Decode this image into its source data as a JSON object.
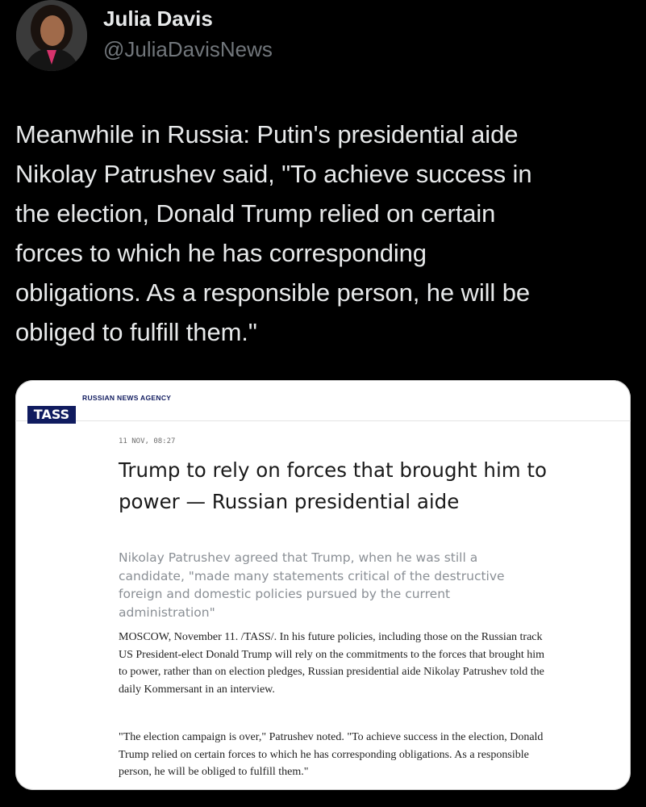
{
  "author": {
    "name": "Julia Davis",
    "handle": "@JuliaDavisNews"
  },
  "tweet": {
    "text": "Meanwhile in Russia: Putin's presidential aide\nNikolay Patrushev said, \"To achieve success in\nthe election, Donald Trump relied on certain\nforces to which he has corresponding\nobligations. As a responsible person, he will be\nobliged to fulfill them.\""
  },
  "article": {
    "logo": "TASS",
    "agency_label": "RUSSIAN NEWS AGENCY",
    "dateline": "11 NOV, 08:27",
    "headline": "Trump to rely on forces that brought him to power — Russian presidential aide",
    "lead": "Nikolay Patrushev agreed that Trump, when he was still a candidate, \"made many statements critical of the destructive foreign and domestic policies pursued by the current administration\"",
    "paragraphs": [
      "MOSCOW, November 11. /TASS/. In his future policies, including those on the Russian track US President-elect Donald Trump will rely on the commitments to the forces that brought him to power, rather than on election pledges, Russian presidential aide Nikolay Patrushev told the daily Kommersant in an interview.",
      "\"The election campaign is over,\" Patrushev noted. \"To achieve success in the election, Donald Trump relied on certain forces to which he has corresponding obligations. As a responsible person, he will be obliged to fulfill them.\""
    ]
  },
  "colors": {
    "background": "#000000",
    "tass_navy": "#101b5f",
    "text_primary": "#e7e9ea",
    "text_secondary": "#71767b"
  }
}
